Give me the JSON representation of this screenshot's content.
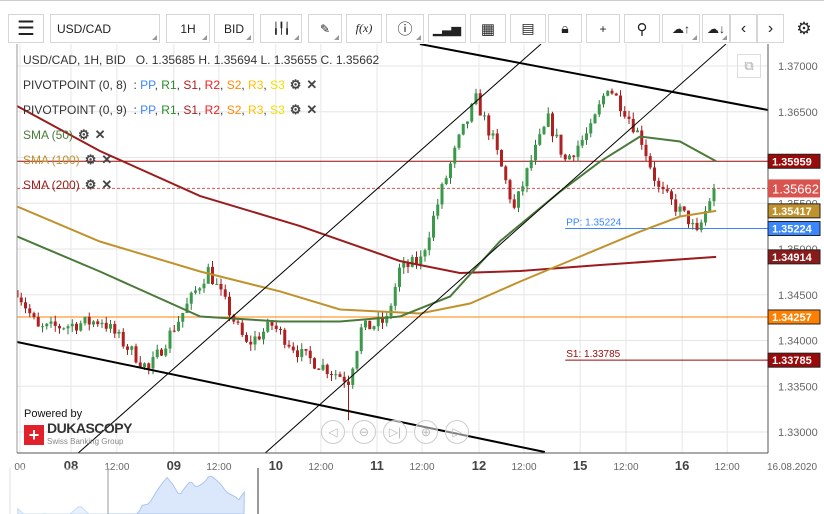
{
  "toolbar": {
    "symbol": "USD/CAD",
    "timeframe": "1H",
    "side": "BID",
    "fx_label": "f(x)"
  },
  "header": {
    "title": "USD/CAD, 1H, BID",
    "ohlc": "O. 1.35685 H. 1.35694 L. 1.35655 C. 1.35662"
  },
  "indicators": [
    {
      "name": "PIVOTPOINT (0, 8)",
      "levels": [
        "PP",
        "R1",
        "S1",
        "R2",
        "S2",
        "R3",
        "S3"
      ]
    },
    {
      "name": "PIVOTPOINT (0, 9)",
      "levels": [
        "PP",
        "R1",
        "S1",
        "R2",
        "S2",
        "R3",
        "S3"
      ]
    },
    {
      "name": "SMA (50)",
      "color": "#4a7a3a"
    },
    {
      "name": "SMA (100)",
      "color": "#c0922e"
    },
    {
      "name": "SMA (200)",
      "color": "#9a1c1c"
    }
  ],
  "level_colors": {
    "PP": "#3a86ff",
    "R1": "#2a8a2a",
    "S1": "#b01c1c",
    "R2": "#ee2020",
    "S2": "#ff8800",
    "R3": "#ffc000",
    "S3": "#f0e000"
  },
  "branding": {
    "powered": "Powered by",
    "brand": "DUKASCOPY",
    "sub": "Swiss Banking Group"
  },
  "chart_data": {
    "type": "candlestick",
    "ylim": [
      1.3265,
      1.3749
    ],
    "y_ticks": [
      "1.37000",
      "1.36500",
      "1.36000",
      "1.35500",
      "1.35000",
      "1.34500",
      "1.34000",
      "1.33500",
      "1.33000"
    ],
    "x_ticks": [
      {
        "h": 0.7,
        "label": "00",
        "bold": false
      },
      {
        "h": 12.7,
        "label": "08",
        "bold": true
      },
      {
        "h": 23.5,
        "label": "12:00",
        "bold": false
      },
      {
        "h": 36.9,
        "label": "09",
        "bold": true
      },
      {
        "h": 47.5,
        "label": "12:00",
        "bold": false
      },
      {
        "h": 60.9,
        "label": "10",
        "bold": true
      },
      {
        "h": 71.5,
        "label": "12:00",
        "bold": false
      },
      {
        "h": 84.7,
        "label": "11",
        "bold": true
      },
      {
        "h": 95.3,
        "label": "12:00",
        "bold": false
      },
      {
        "h": 108.7,
        "label": "12",
        "bold": true
      },
      {
        "h": 119.3,
        "label": "12:00",
        "bold": false
      },
      {
        "h": 132.5,
        "label": "15",
        "bold": true
      },
      {
        "h": 143.3,
        "label": "12:00",
        "bold": false
      },
      {
        "h": 156.5,
        "label": "16",
        "bold": true
      },
      {
        "h": 167.1,
        "label": "12:00",
        "bold": false
      }
    ],
    "date_label": "16.08.2020",
    "price_path": [
      [
        0,
        1.3455
      ],
      [
        5,
        1.3412
      ],
      [
        20,
        1.3422
      ],
      [
        31,
        1.3368
      ],
      [
        45,
        1.3477
      ],
      [
        54,
        1.3395
      ],
      [
        60,
        1.3417
      ],
      [
        67,
        1.3384
      ],
      [
        78,
        1.3357
      ],
      [
        81,
        1.3412
      ],
      [
        87,
        1.3422
      ],
      [
        90,
        1.3477
      ],
      [
        95,
        1.3488
      ],
      [
        100,
        1.3565
      ],
      [
        104,
        1.3619
      ],
      [
        108,
        1.3663
      ],
      [
        112,
        1.3619
      ],
      [
        117,
        1.3543
      ],
      [
        121,
        1.3597
      ],
      [
        125,
        1.3641
      ],
      [
        129,
        1.3597
      ],
      [
        135,
        1.363
      ],
      [
        139,
        1.3679
      ],
      [
        143,
        1.3652
      ],
      [
        147,
        1.3619
      ],
      [
        151,
        1.3565
      ],
      [
        158,
        1.3532
      ],
      [
        160,
        1.3515
      ],
      [
        163,
        1.3554
      ],
      [
        164,
        1.35662
      ]
    ],
    "sma50": [
      [
        0,
        1.35137
      ],
      [
        19.5,
        1.34754
      ],
      [
        43.1,
        1.34262
      ],
      [
        61.9,
        1.34208
      ],
      [
        76,
        1.34208
      ],
      [
        90.1,
        1.34262
      ],
      [
        101.9,
        1.34481
      ],
      [
        113.6,
        1.35082
      ],
      [
        127.8,
        1.35628
      ],
      [
        137.2,
        1.35956
      ],
      [
        146.6,
        1.36229
      ],
      [
        156,
        1.36175
      ],
      [
        164.5,
        1.35959
      ]
    ],
    "sma100": [
      [
        0,
        1.35465
      ],
      [
        19.5,
        1.35082
      ],
      [
        43.1,
        1.34754
      ],
      [
        61.9,
        1.34536
      ],
      [
        76,
        1.34339
      ],
      [
        94.8,
        1.34295
      ],
      [
        106.6,
        1.34404
      ],
      [
        118.4,
        1.34645
      ],
      [
        132.5,
        1.34918
      ],
      [
        146.6,
        1.35191
      ],
      [
        156,
        1.35355
      ],
      [
        164.5,
        1.35417
      ]
    ],
    "sma200": [
      [
        0,
        1.36563
      ],
      [
        19.5,
        1.36071
      ],
      [
        43.1,
        1.35579
      ],
      [
        66.6,
        1.35251
      ],
      [
        90.1,
        1.34869
      ],
      [
        104.2,
        1.34738
      ],
      [
        118.4,
        1.3476
      ],
      [
        137.2,
        1.34825
      ],
      [
        164.5,
        1.34914
      ]
    ],
    "trendlines": [
      {
        "from": [
          0,
          1.33984
        ],
        "to": [
          124.2,
          1.32781
        ],
        "color": "#000",
        "width": 2
      },
      {
        "from": [
          94.8,
          1.3724
        ],
        "to": [
          176.7,
          1.36519
        ],
        "color": "#000",
        "width": 2
      },
      {
        "from": [
          14.4,
          1.3277
        ],
        "to": [
          123.3,
          1.3724
        ],
        "color": "#000",
        "width": 1
      },
      {
        "from": [
          58.4,
          1.3277
        ],
        "to": [
          166.8,
          1.3724
        ],
        "color": "#000",
        "width": 1
      }
    ],
    "levels": [
      {
        "value": 1.35959,
        "label": "1.35959",
        "color": "#9a0a0a",
        "dash": false,
        "from_h": 0
      },
      {
        "value": 1.35662,
        "label": "1.35662",
        "color": "#d9534f",
        "dash": true,
        "from_h": 0,
        "current": true
      },
      {
        "value": 1.35417,
        "label": "1.35417",
        "color": "#c0922e",
        "dash": false,
        "no_line": true
      },
      {
        "value": 1.35224,
        "label": "1.35224",
        "color": "#3a86ff",
        "dash": false,
        "from_h": 129,
        "text": "PP: 1.35224"
      },
      {
        "value": 1.34914,
        "label": "1.34914",
        "color": "#8b1a1a",
        "dash": false,
        "no_line": true
      },
      {
        "value": 1.34257,
        "label": "1.34257",
        "color": "#ff8000",
        "dash": false,
        "from_h": 0
      },
      {
        "value": 1.33785,
        "label": "1.33785",
        "color": "#9a0a0a",
        "dash": false,
        "from_h": 129,
        "text": "S1: 1.33785"
      }
    ]
  }
}
